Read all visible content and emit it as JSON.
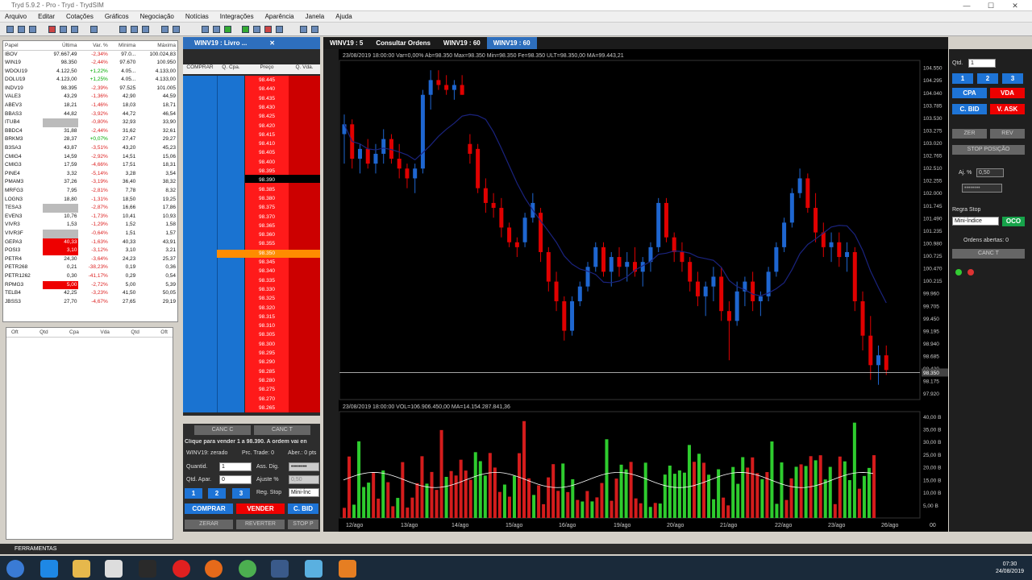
{
  "window": {
    "title": "Tryd 5.9.2 - Pro - Tryd - TrydSIM"
  },
  "menu": [
    "Arquivo",
    "Editar",
    "Cotações",
    "Gráficos",
    "Negociação",
    "Notícias",
    "Integrações",
    "Aparência",
    "Janela",
    "Ajuda"
  ],
  "quotes": {
    "headers": [
      "Papel",
      "Última",
      "Var. %",
      "Mínima",
      "Máxima"
    ],
    "rows": [
      [
        "IBOV",
        "97.667,49",
        "-2,34%",
        "97.0...",
        "100.024,83"
      ],
      [
        "WIN19",
        "98.350",
        "-2,44%",
        "97.670",
        "100.950"
      ],
      [
        "WDOU19",
        "4.122,50",
        "+1,22%",
        "4.05...",
        "4.133,00"
      ],
      [
        "DOLU19",
        "4.123,00",
        "+1,25%",
        "4.05...",
        "4.133,00"
      ],
      [
        "INDV19",
        "98.395",
        "-2,39%",
        "97.525",
        "101.005"
      ],
      [
        "VALE3",
        "43,29",
        "-1,36%",
        "42,90",
        "44,59"
      ],
      [
        "ABEV3",
        "18,21",
        "-1,46%",
        "18,03",
        "18,71"
      ],
      [
        "BBAS3",
        "44,82",
        "-3,92%",
        "44,72",
        "46,54"
      ],
      [
        "ITUB4",
        "",
        "-0,80%",
        "32,93",
        "33,90"
      ],
      [
        "BBDC4",
        "31,88",
        "-2,44%",
        "31,62",
        "32,61"
      ],
      [
        "BRKM3",
        "28,37",
        "+0,07%",
        "27,47",
        "29,27"
      ],
      [
        "B3SA3",
        "43,87",
        "-3,51%",
        "43,20",
        "45,23"
      ],
      [
        "CMIG4",
        "14,59",
        "-2,92%",
        "14,51",
        "15,06"
      ],
      [
        "CMIG3",
        "17,59",
        "-4,66%",
        "17,51",
        "18,31"
      ],
      [
        "PINE4",
        "3,32",
        "-5,14%",
        "3,28",
        "3,54"
      ],
      [
        "PMAM3",
        "37,26",
        "-3,19%",
        "36,40",
        "38,32"
      ],
      [
        "MRFG3",
        "7,95",
        "-2,81%",
        "7,78",
        "8,32"
      ],
      [
        "LOGN3",
        "18,80",
        "-1,31%",
        "18,50",
        "19,25"
      ],
      [
        "TESA3",
        "",
        "-2,87%",
        "16,66",
        "17,86"
      ],
      [
        "EVEN3",
        "10,76",
        "-1,73%",
        "10,41",
        "10,93"
      ],
      [
        "VIVR3",
        "1,53",
        "-1,29%",
        "1,52",
        "1,58"
      ],
      [
        "VIVR3F",
        "",
        "-0,64%",
        "1,51",
        "1,57"
      ],
      [
        "GEPA3",
        "40,33",
        "-1,63%",
        "40,33",
        "43,91"
      ],
      [
        "POSI3",
        "3,10",
        "-3,12%",
        "3,10",
        "3,21"
      ],
      [
        "PETR4",
        "24,30",
        "-3,64%",
        "24,23",
        "25,37"
      ],
      [
        "PETR268",
        "0,21",
        "-38,23%",
        "0,19",
        "0,36"
      ],
      [
        "PETR1262",
        "0,30",
        "-41,17%",
        "0,29",
        "0,54"
      ],
      [
        "RPMG3",
        "5,00",
        "-2,72%",
        "5,00",
        "5,39"
      ],
      [
        "TELB4",
        "42,25",
        "-3,23%",
        "41,50",
        "50,05"
      ],
      [
        "JBSS3",
        "27,70",
        "-4,67%",
        "27,65",
        "29,19"
      ]
    ]
  },
  "orders": {
    "headers": [
      "Oft",
      "Qtd",
      "Cpa",
      "Vda",
      "Qtd",
      "Oft"
    ]
  },
  "footer": {
    "ferramentas": "FERRAMENTAS"
  },
  "book": {
    "title": "WINV19 : Livro ...",
    "cols": [
      "COMPRAR",
      "Q. Cpa.",
      "Preço",
      "Q. Vda."
    ],
    "prices": [
      "98.445",
      "98.440",
      "98.435",
      "98.430",
      "98.425",
      "98.420",
      "98.415",
      "98.410",
      "98.405",
      "98.400",
      "98.395",
      "98.390",
      "98.385",
      "98.380",
      "98.375",
      "98.370",
      "98.365",
      "98.360",
      "98.355",
      "98.350",
      "98.345",
      "98.340",
      "98.335",
      "98.330",
      "98.325",
      "98.320",
      "98.315",
      "98.310",
      "98.305",
      "98.300",
      "98.295",
      "98.290",
      "98.285",
      "98.280",
      "98.275",
      "98.270",
      "98.265"
    ],
    "canc_c": "CANC C",
    "canc_t": "CANC T",
    "info": "Clique para vender 1 a 98.390. A ordem vai en",
    "status": "WINV19: zerado",
    "prc_trade": "Prc. Trade: 0",
    "aber": "Aber.: 0 pts",
    "quantid_label": "Quantid.",
    "quantid_value": "1",
    "ass_dig_label": "Ass. Dig.",
    "ass_dig_value": "••••••••",
    "qtd_apar_label": "Qtd. Apar.",
    "qtd_apar_value": "0",
    "ajuste_label": "Ajuste %",
    "ajuste_value": "0,50",
    "q1": "1",
    "q2": "2",
    "q3": "3",
    "reg_stop_label": "Reg. Stop",
    "reg_stop_value": "Mini-Ínc",
    "comprar": "COMPRAR",
    "vender": "VENDER",
    "cbid": "C. BID",
    "zerar": "ZERAR",
    "reverter": "REVERTER",
    "stop": "STOP P"
  },
  "chart_tabs": [
    "WINV19 : 5",
    "Consultar Ordens",
    "WINV19 : 60",
    "WINV19 : 60"
  ],
  "chart_data": [
    {
      "type": "candlestick",
      "header": "23/08/2019 18:00:00  Var=0,00%  Ab=98.350  Max=98.350  Min=98.350  Fe=98.350  ULT=98.350,00  MA=99.443,21",
      "yticks": [
        "104.550",
        "104.295",
        "104.040",
        "103.785",
        "103.530",
        "103.275",
        "103.020",
        "102.765",
        "102.510",
        "102.255",
        "102.000",
        "101.745",
        "101.490",
        "101.235",
        "100.980",
        "100.725",
        "100.470",
        "100.215",
        "99.960",
        "99.705",
        "99.450",
        "99.195",
        "98.940",
        "98.685",
        "98.430",
        "98.175",
        "97.920"
      ],
      "ylim": [
        97.8,
        104.7
      ],
      "last_price": "98.350",
      "candles": [
        [
          103.2,
          103.6,
          102.6,
          103.4
        ],
        [
          103.4,
          103.5,
          102.5,
          102.7
        ],
        [
          102.7,
          103.0,
          102.4,
          102.9
        ],
        [
          102.9,
          103.1,
          102.5,
          102.6
        ],
        [
          102.6,
          103.0,
          102.4,
          102.8
        ],
        [
          102.8,
          103.3,
          102.6,
          103.1
        ],
        [
          103.1,
          103.2,
          102.6,
          102.7
        ],
        [
          102.7,
          103.0,
          102.3,
          102.5
        ],
        [
          102.5,
          102.6,
          102.1,
          102.3
        ],
        [
          102.3,
          102.6,
          102.0,
          102.5
        ],
        [
          102.5,
          104.1,
          102.4,
          104.0
        ],
        [
          104.0,
          104.5,
          103.7,
          104.3
        ],
        [
          104.3,
          104.5,
          104.1,
          104.2
        ],
        [
          104.2,
          104.4,
          104.0,
          104.1
        ],
        [
          104.1,
          104.3,
          103.9,
          104.2
        ],
        [
          104.2,
          104.4,
          104.0,
          104.0
        ],
        [
          103.0,
          103.2,
          102.6,
          102.8
        ],
        [
          102.9,
          103.0,
          102.0,
          102.1
        ],
        [
          102.1,
          102.3,
          101.6,
          101.8
        ],
        [
          101.8,
          102.0,
          101.5,
          101.7
        ],
        [
          101.7,
          101.9,
          101.1,
          101.3
        ],
        [
          101.3,
          101.4,
          100.9,
          101.0
        ],
        [
          101.0,
          101.1,
          100.7,
          100.9
        ],
        [
          101.0,
          101.6,
          100.9,
          101.5
        ],
        [
          101.5,
          102.0,
          101.4,
          101.8
        ],
        [
          101.6,
          101.7,
          100.6,
          100.8
        ],
        [
          100.8,
          100.9,
          100.0,
          100.2
        ],
        [
          100.2,
          100.4,
          99.6,
          99.8
        ],
        [
          99.8,
          99.9,
          99.0,
          99.2
        ],
        [
          99.2,
          99.9,
          99.1,
          99.8
        ],
        [
          99.8,
          100.2,
          99.7,
          100.1
        ],
        [
          100.1,
          100.6,
          100.0,
          100.5
        ],
        [
          100.5,
          101.0,
          100.4,
          100.9
        ],
        [
          100.9,
          101.0,
          100.3,
          100.4
        ],
        [
          100.4,
          100.8,
          100.1,
          100.7
        ],
        [
          100.7,
          100.9,
          100.3,
          100.5
        ],
        [
          100.5,
          100.8,
          100.2,
          100.6
        ],
        [
          100.6,
          100.9,
          100.3,
          100.4
        ],
        [
          100.4,
          100.7,
          100.1,
          100.6
        ],
        [
          100.6,
          101.0,
          100.4,
          100.9
        ],
        [
          100.9,
          101.9,
          100.8,
          101.8
        ],
        [
          101.8,
          101.9,
          101.0,
          101.1
        ],
        [
          101.1,
          101.2,
          100.6,
          100.8
        ],
        [
          100.8,
          101.0,
          100.4,
          100.6
        ],
        [
          100.6,
          100.7,
          100.0,
          100.2
        ],
        [
          100.2,
          100.4,
          99.7,
          99.9
        ],
        [
          99.9,
          100.2,
          99.5,
          100.1
        ],
        [
          100.1,
          100.5,
          99.8,
          100.3
        ],
        [
          100.3,
          100.5,
          99.4,
          99.6
        ],
        [
          99.6,
          99.8,
          98.6,
          99.4
        ],
        [
          99.4,
          100.2,
          99.3,
          100.0
        ],
        [
          100.0,
          100.3,
          99.7,
          100.2
        ],
        [
          100.2,
          100.4,
          99.6,
          99.8
        ],
        [
          99.8,
          100.0,
          99.5,
          99.9
        ],
        [
          99.9,
          100.5,
          99.8,
          100.4
        ],
        [
          100.4,
          101.0,
          100.3,
          100.9
        ],
        [
          100.9,
          101.5,
          100.8,
          101.4
        ],
        [
          101.4,
          102.1,
          101.3,
          102.0
        ],
        [
          102.0,
          102.5,
          101.9,
          102.3
        ],
        [
          102.3,
          102.4,
          101.6,
          101.7
        ],
        [
          101.7,
          102.0,
          101.0,
          101.2
        ],
        [
          101.2,
          101.4,
          100.7,
          100.9
        ],
        [
          100.9,
          101.2,
          100.6,
          101.0
        ],
        [
          101.0,
          101.2,
          100.5,
          100.7
        ],
        [
          100.7,
          101.0,
          100.4,
          100.8
        ],
        [
          100.8,
          100.9,
          99.6,
          99.8
        ],
        [
          99.8,
          100.0,
          98.8,
          99.1
        ],
        [
          99.1,
          99.5,
          98.2,
          98.5
        ],
        [
          98.5,
          98.9,
          98.1,
          98.7
        ],
        [
          98.7,
          98.9,
          98.3,
          98.4
        ]
      ]
    },
    {
      "type": "bar",
      "header": "23/08/2019 18:00:00  VOL=106.906.450,00  MA=14.154.287.841,36",
      "yticks": [
        "40,00 B",
        "35,00 B",
        "30,00 B",
        "25,00 B",
        "20,00 B",
        "15,00 B",
        "10,00 B",
        "5,00 B"
      ],
      "ylim": [
        0,
        42
      ],
      "xticks": [
        "12/ago",
        "13/ago",
        "14/ago",
        "15/ago",
        "16/ago",
        "19/ago",
        "20/ago",
        "21/ago",
        "22/ago",
        "23/ago",
        "26/ago"
      ],
      "xlabel_right": "00"
    }
  ],
  "right_panel": {
    "qtd_label": "Qtd.",
    "qtd_value": "1",
    "q1": "1",
    "q2": "2",
    "q3": "3",
    "cpa": "CPA",
    "vda": "VDA",
    "cbid": "C. BID",
    "vask": "V. ASK",
    "zer": "ZER",
    "rev": "REV",
    "stop": "STOP POSIÇÃO",
    "aj_label": "Aj. %",
    "aj_value": "0,50",
    "password": "••••••••",
    "regra_label": "Regra Stop",
    "regra_value": "Mini-Índice",
    "oco": "OCO",
    "ordens": "Ordens abertas: 0",
    "canc_t": "CANC T"
  },
  "clock": {
    "time": "07:30",
    "date": "24/08/2019"
  },
  "colors": {
    "buy": "#1e74d6",
    "sell": "#e00000",
    "accent": "#2e6fbd",
    "up_candle": "#1e66d0",
    "down_candle": "#e00000"
  }
}
